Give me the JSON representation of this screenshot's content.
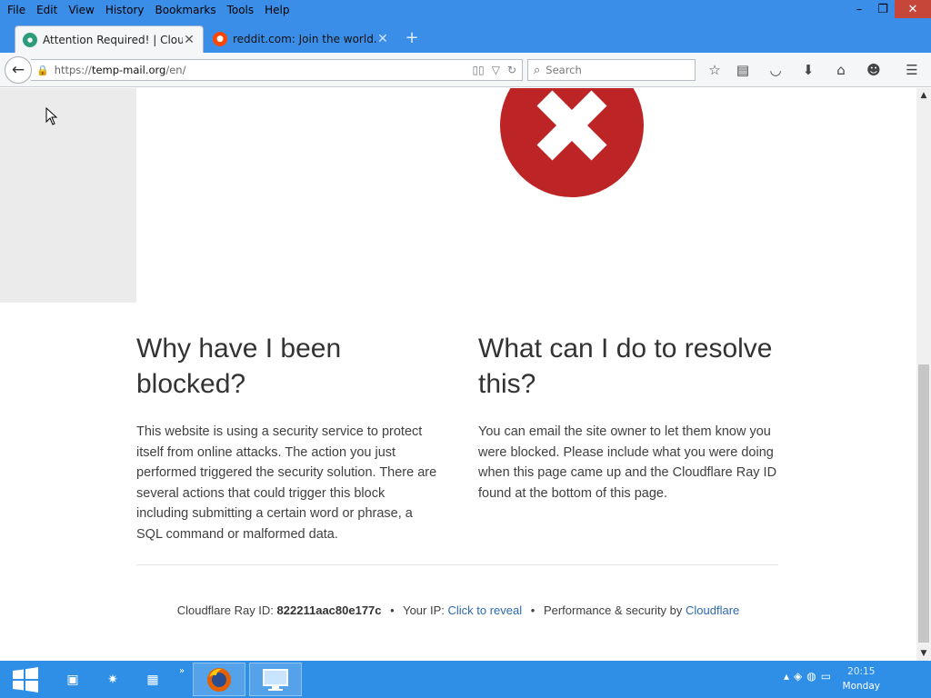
{
  "menu": [
    "File",
    "Edit",
    "View",
    "History",
    "Bookmarks",
    "Tools",
    "Help"
  ],
  "window_controls": {
    "minimize": "–",
    "restore": "❐",
    "close": "✕"
  },
  "tabs": [
    {
      "title": "Attention Required! | Cloud...",
      "favicon": "temp-mail-favicon",
      "active": true
    },
    {
      "title": "reddit.com: Join the world...",
      "favicon": "reddit-favicon",
      "active": false
    }
  ],
  "urlbar": {
    "prefix": "https://",
    "domain": "temp-mail.org",
    "path": "/en/"
  },
  "search": {
    "placeholder": "Search"
  },
  "page": {
    "left": {
      "heading": "Why have I been blocked?",
      "body": "This website is using a security service to protect itself from online attacks. The action you just performed triggered the security solution. There are several actions that could trigger this block including submitting a certain word or phrase, a SQL command or malformed data."
    },
    "right": {
      "heading": "What can I do to resolve this?",
      "body": "You can email the site owner to let them know you were blocked. Please include what you were doing when this page came up and the Cloudflare Ray ID found at the bottom of this page."
    },
    "footer": {
      "ray_label": "Cloudflare Ray ID:",
      "ray_id": "822211aac80e177c",
      "separator": "•",
      "ip_label": "Your IP:",
      "ip_link": "Click to reveal",
      "perf_label": "Performance & security by",
      "perf_link": "Cloudflare"
    }
  },
  "taskbar": {
    "time": "20:15",
    "day": "Monday"
  },
  "colors": {
    "chrome_blue": "#3b8ee8",
    "error_red": "#bd2426",
    "link_blue": "#2c6aae",
    "taskbar_blue": "#2f8fe6"
  }
}
